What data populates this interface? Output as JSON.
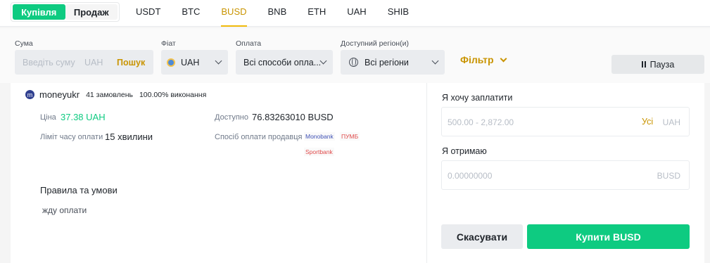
{
  "trade_toggle": {
    "buy": "Купівля",
    "sell": "Продаж"
  },
  "assets": [
    "USDT",
    "BTC",
    "BUSD",
    "BNB",
    "ETH",
    "UAH",
    "SHIB"
  ],
  "active_asset": "BUSD",
  "filters": {
    "amount_label": "Сума",
    "amount_placeholder": "Введіть суму",
    "amount_currency": "UAH",
    "search": "Пошук",
    "fiat_label": "Фіат",
    "fiat_value": "UAH",
    "payment_label": "Оплата",
    "payment_value": "Всі способи опла...",
    "region_label": "Доступний регіон(и)",
    "region_value": "Всі регіони",
    "filter_button": "Фільтр",
    "pause_button": "Пауза"
  },
  "merchant": {
    "avatar_letter": "m",
    "name": "moneyukr",
    "orders": "41 замовлень",
    "completion": "100.00% виконання"
  },
  "offer": {
    "price_label": "Ціна",
    "price_value": "37.38 UAH",
    "time_limit_label": "Ліміт часу оплати",
    "time_limit_value": "15 хвилини",
    "available_label": "Доступно",
    "available_value": "76.83263010 BUSD",
    "payment_methods_label": "Спосіб оплати продавця",
    "payment_methods": [
      "Monobank",
      "ПУМБ",
      "Sportbank"
    ]
  },
  "terms": {
    "title": "Правила та умови",
    "body": "жду оплати"
  },
  "order_form": {
    "pay_label": "Я хочу заплатити",
    "pay_placeholder": "500.00 - 2,872.00",
    "pay_all": "Усі",
    "pay_currency": "UAH",
    "receive_label": "Я отримаю",
    "receive_placeholder": "0.00000000",
    "receive_currency": "BUSD",
    "cancel_button": "Скасувати",
    "buy_button": "Купити BUSD"
  },
  "colors": {
    "accent_green": "#0ecb81",
    "accent_gold": "#c99400",
    "tab_underline": "#f0b90b"
  }
}
